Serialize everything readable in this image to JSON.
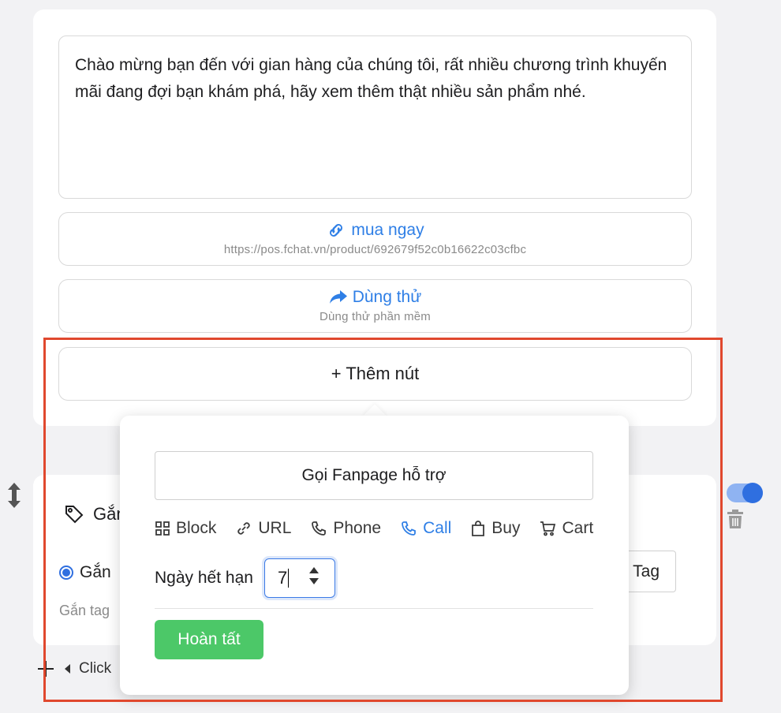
{
  "message": {
    "text": "Chào mừng bạn đến với gian hàng của chúng tôi, rất nhiều chương trình khuyến mãi đang đợi bạn khám phá, hãy xem thêm thật nhiều sản phẩm nhé."
  },
  "buttons": [
    {
      "icon": "link-icon",
      "title": "mua ngay",
      "subtitle": "https://pos.fchat.vn/product/692679f52c0b16622c03cfbc"
    },
    {
      "icon": "share-arrow-icon",
      "title": "Dùng thử",
      "subtitle": "Dùng thử phần mềm"
    }
  ],
  "add_button": {
    "label": "+ Thêm nút"
  },
  "tag_section": {
    "title_partial": "Gắn",
    "radio_label_partial": "Gắn",
    "hint_partial": "Gắn tag",
    "tag_button_partial": "Tag"
  },
  "footer": {
    "label_partial": "Click"
  },
  "popover": {
    "name_value": "Gọi Fanpage hỗ trợ",
    "types": [
      {
        "icon": "grid-icon",
        "label": "Block"
      },
      {
        "icon": "link-icon",
        "label": "URL"
      },
      {
        "icon": "phone-icon",
        "label": "Phone"
      },
      {
        "icon": "phone-call-icon",
        "label": "Call"
      },
      {
        "icon": "bag-icon",
        "label": "Buy"
      },
      {
        "icon": "cart-icon",
        "label": "Cart"
      }
    ],
    "selected_type": "Call",
    "expiry_label": "Ngày hết hạn",
    "expiry_value": "7",
    "done_label": "Hoàn tất"
  },
  "colors": {
    "accent": "#2f7fe6",
    "success": "#4cc868",
    "highlight": "#e0482e"
  }
}
